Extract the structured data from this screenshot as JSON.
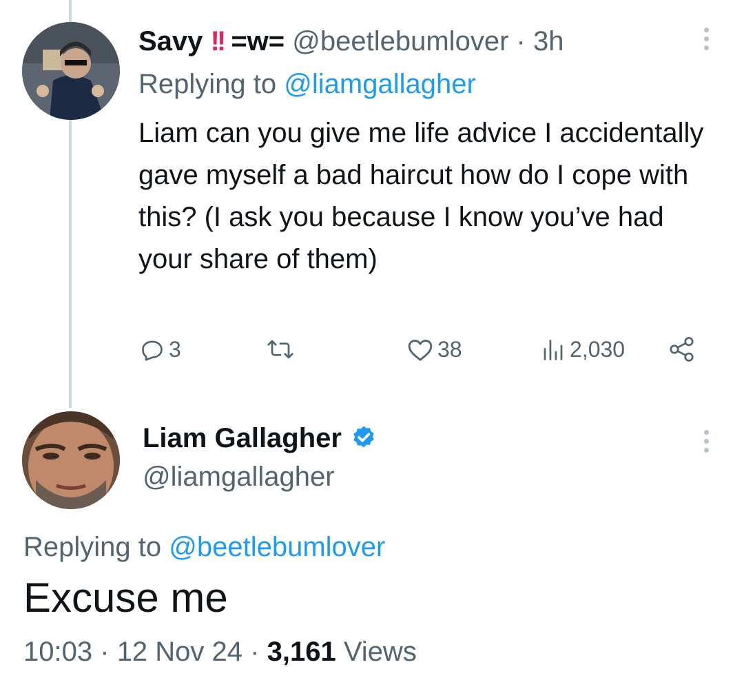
{
  "parent_tweet": {
    "display_name": "Savy",
    "name_emoji": "!!",
    "name_suffix": "=w=",
    "handle": "@beetlebumlover",
    "separator": "·",
    "time": "3h",
    "replying_prefix": "Replying to",
    "replying_to": "@liamgallagher",
    "text": "Liam can you give me life advice I accidentally gave myself a bad haircut how do I cope with this? (I ask you because I know you’ve had your share of them)",
    "actions": {
      "replies": "3",
      "likes": "38",
      "views": "2,030"
    },
    "icons": [
      "reply-icon",
      "retweet-icon",
      "like-icon",
      "views-icon",
      "share-icon",
      "more-icon"
    ]
  },
  "main_tweet": {
    "display_name": "Liam Gallagher",
    "verified": true,
    "handle": "@liamgallagher",
    "replying_prefix": "Replying to",
    "replying_to": "@beetlebumlover",
    "text": "Excuse me",
    "time": "10:03",
    "separator": "·",
    "date": "12 Nov 24",
    "views_count": "3,161",
    "views_label": "Views"
  },
  "colors": {
    "link": "#1d9bf0",
    "muted": "#536471",
    "text": "#0f1419",
    "thread_line": "#cfd9de",
    "emoji_red": "#e0245e",
    "verified": "#1d9bf0"
  }
}
